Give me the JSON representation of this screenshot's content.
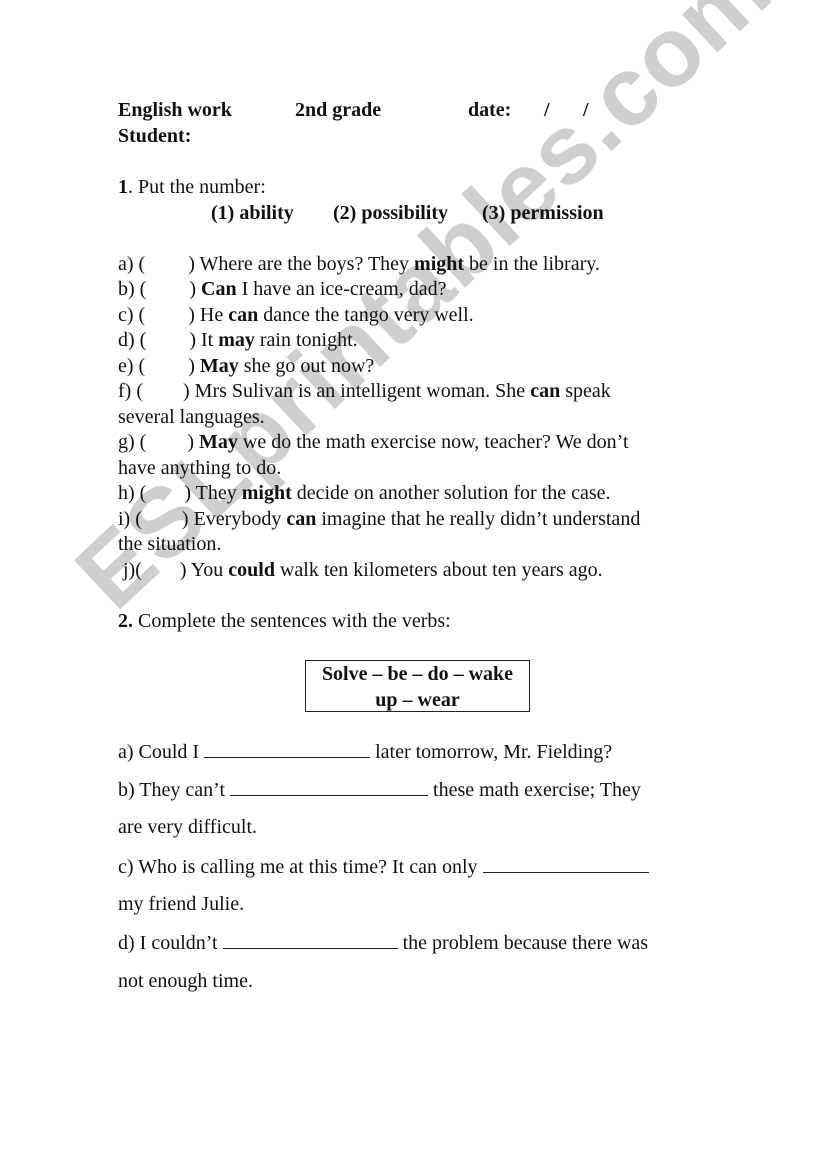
{
  "header": {
    "subject": "English work",
    "grade": "2nd grade",
    "date_label": "date:",
    "date_separators": [
      "/",
      "/"
    ],
    "student_label": "Student:"
  },
  "section1": {
    "number": "1",
    "instruction": ". Put the number:",
    "categories": [
      "(1) ability",
      "(2) possibility",
      "(3) permission"
    ],
    "items": [
      {
        "letter": "a) (",
        "close": ")",
        "pre": "Where are the boys? They ",
        "modal": "might",
        "post": " be in the library.",
        "cont": ""
      },
      {
        "letter": "b) (",
        "close": ")",
        "pre": "",
        "modal": "Can",
        "post": " I have an ice-cream, dad?",
        "cont": ""
      },
      {
        "letter": "c) (",
        "close": ")",
        "pre": "He ",
        "modal": "can",
        "post": " dance the tango very well.",
        "cont": ""
      },
      {
        "letter": "d) (",
        "close": ")",
        "pre": "It ",
        "modal": "may",
        "post": " rain tonight.",
        "cont": ""
      },
      {
        "letter": "e) (",
        "close": ")",
        "pre": "",
        "modal": "May",
        "post": " she go out now?",
        "cont": ""
      },
      {
        "letter": "f) (",
        "close": ")",
        "pre": "Mrs Sulivan is an intelligent woman. She ",
        "modal": "can",
        "post": " speak",
        "cont": "several languages."
      },
      {
        "letter": "g) (",
        "close": ")",
        "pre": " ",
        "modal": "May",
        "post": " we do the math exercise now, teacher? We don’t",
        "cont": "have anything to do."
      },
      {
        "letter": "h) (",
        "close": ")",
        "pre": "They ",
        "modal": "might",
        "post": " decide on another solution for the case.",
        "cont": ""
      },
      {
        "letter": "i) (",
        "close": ")",
        "pre": "Everybody ",
        "modal": "can",
        "post": " imagine that he really didn’t understand",
        "cont": "the situation."
      },
      {
        "letter": " j)(",
        "close": ")",
        "pre": "You ",
        "modal": "could",
        "post": " walk ten kilometers about ten years ago.",
        "cont": ""
      }
    ]
  },
  "section2": {
    "number": "2.",
    "instruction": " Complete the sentences with the verbs:",
    "verb_box": {
      "line1": "Solve – be – do – wake",
      "line2": "up – wear"
    },
    "items": [
      {
        "pre": "a) Could I ",
        "post": " later tomorrow, Mr. Fielding?",
        "cont": ""
      },
      {
        "pre": "b) They can’t ",
        "post": " these math exercise; They",
        "cont": "are very difficult."
      },
      {
        "pre": "c) Who is calling me at this time? It can only ",
        "post": "",
        "cont": "my friend Julie."
      },
      {
        "pre": "d) I couldn’t ",
        "post": " the problem because there was",
        "cont": "not enough time."
      }
    ]
  },
  "watermark": {
    "text": "ESLprintables.com",
    "color": "#cfcfcf"
  }
}
